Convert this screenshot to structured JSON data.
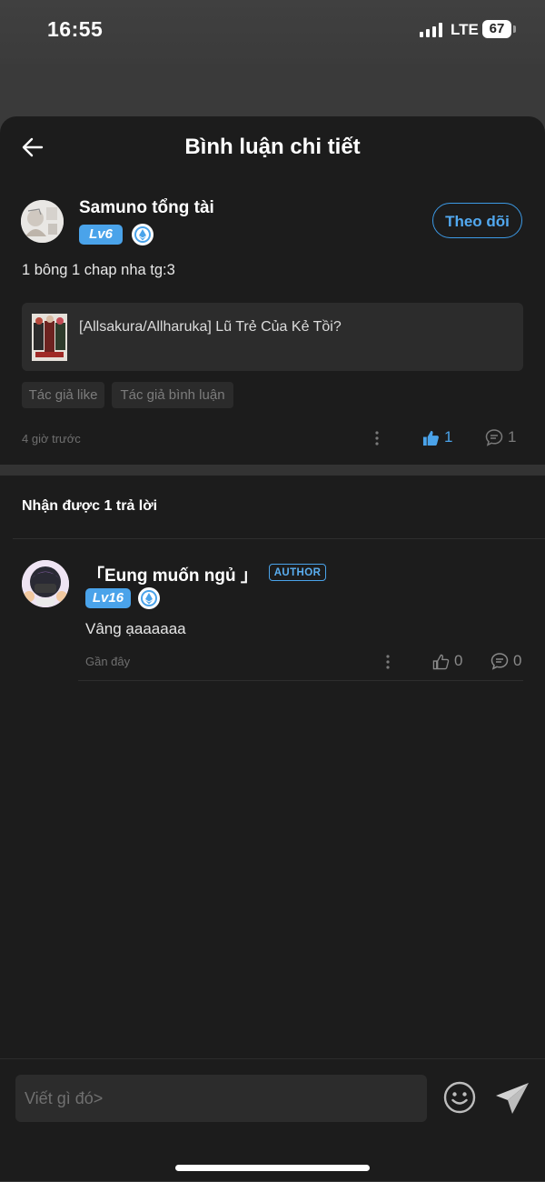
{
  "status_bar": {
    "time": "16:55",
    "network": "LTE",
    "battery": "67"
  },
  "header": {
    "title": "Bình luận chi tiết",
    "back_icon": "arrow-left-icon"
  },
  "comment": {
    "username": "Samuno tổng tài",
    "level": "Lv6",
    "follow_label": "Theo dõi",
    "text": "1 bông 1 chap nha tg:3",
    "book_title": "[Allsakura/Allharuka] Lũ Trẻ Của Kẻ Tồi?",
    "tags": [
      "Tác giả like",
      "Tác giả bình luận"
    ],
    "time": "4 giờ trước",
    "likes": "1",
    "replies": "1",
    "liked": true
  },
  "replies_section": {
    "heading": "Nhận được 1 trả lời",
    "items": [
      {
        "username": "「Eung muốn ngủ 」",
        "badge": "AUTHOR",
        "level": "Lv16",
        "text": "Vâng ạaaaaaa",
        "time": "Gần đây",
        "likes": "0",
        "replies": "0"
      }
    ]
  },
  "input": {
    "placeholder": "Viết gì đó>"
  },
  "colors": {
    "accent": "#4aa3ea",
    "background": "#1c1c1c",
    "card": "#2c2c2c"
  }
}
